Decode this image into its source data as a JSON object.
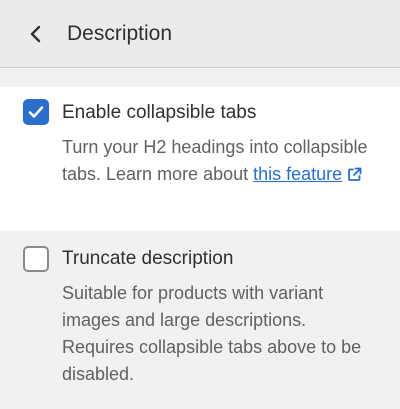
{
  "header": {
    "back_icon": "chevron-left-icon",
    "title": "Description"
  },
  "settings": [
    {
      "label": "Enable collapsible tabs",
      "checked": true,
      "help_text": "Turn your H2 headings into collapsible tabs. Learn more about",
      "link_text": "this feature",
      "link_icon": "external-link-icon"
    },
    {
      "label": "Truncate description",
      "checked": false,
      "help_text": "Suitable for products with variant images and large descriptions. Requires collapsible tabs above to be disabled."
    }
  ],
  "colors": {
    "accent": "#2c6ecb",
    "header_bg": "#ebebeb",
    "panel_bg": "#f1f1f1",
    "selected_bg": "#ffffff"
  }
}
